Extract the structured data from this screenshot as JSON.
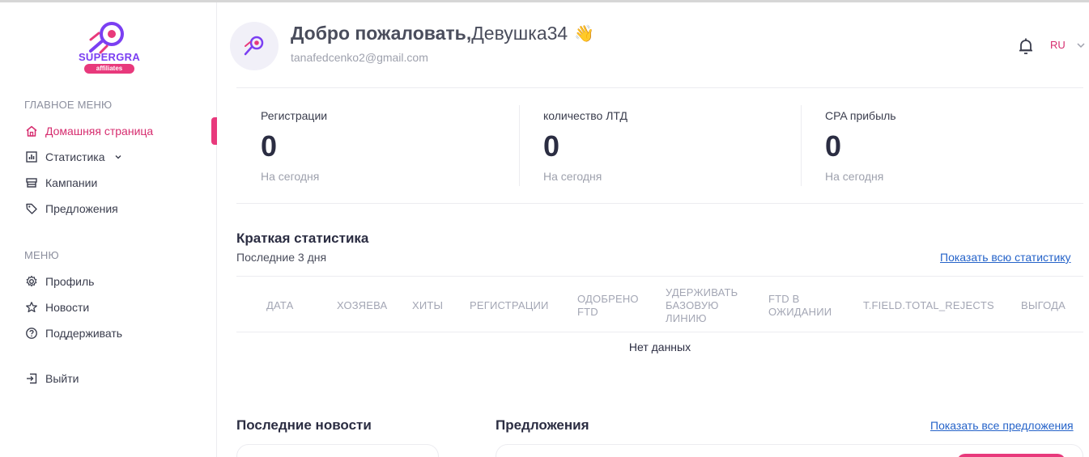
{
  "brand": {
    "logo_text": "SUPERGRA",
    "logo_badge": "affiliates",
    "accent_color": "#e8397c",
    "logo_color": "#7b3ff2"
  },
  "sidebar": {
    "main_menu_title": "ГЛАВНОЕ МЕНЮ",
    "main_items": [
      {
        "label": "Домашняя страница",
        "icon": "home-icon",
        "active": true
      },
      {
        "label": "Статистика",
        "icon": "bar-chart-icon",
        "has_dropdown": true
      },
      {
        "label": "Кампании",
        "icon": "campaign-icon"
      },
      {
        "label": "Предложения",
        "icon": "tag-icon"
      }
    ],
    "menu_title": "МЕНЮ",
    "menu_items": [
      {
        "label": "Профиль",
        "icon": "gear-icon"
      },
      {
        "label": "Новости",
        "icon": "star-icon"
      },
      {
        "label": "Поддерживать",
        "icon": "help-circle-icon"
      }
    ],
    "logout_label": "Выйти",
    "logout_icon": "logout-icon"
  },
  "header": {
    "welcome_bold": "Добро пожаловать,",
    "username": "Девушка34",
    "wave": "👋",
    "email": "tanafedcenko2@gmail.com",
    "language": "RU"
  },
  "kpis": [
    {
      "label": "Регистрации",
      "value": "0",
      "sub": "На сегодня"
    },
    {
      "label": "количество ЛТД",
      "value": "0",
      "sub": "На сегодня"
    },
    {
      "label": "CPA прибыль",
      "value": "0",
      "sub": "На сегодня"
    }
  ],
  "short_stats": {
    "title": "Краткая статистика",
    "subtitle": "Последние 3 дня",
    "show_all_link": "Показать всю статистику",
    "columns": [
      "ДАТА",
      "ХОЗЯЕВА",
      "ХИТЫ",
      "РЕГИСТРАЦИИ",
      "ОДОБРЕНО FTD",
      "УДЕРЖИВАТЬ БАЗОВУЮ ЛИНИЮ",
      "FTD В ОЖИДАНИИ",
      "T.FIELD.TOTAL_REJECTS",
      "ВЫГОДА"
    ],
    "empty_text": "Нет данных"
  },
  "news": {
    "title": "Последние новости"
  },
  "offers": {
    "title": "Предложения",
    "show_all_link": "Показать все предложения"
  }
}
